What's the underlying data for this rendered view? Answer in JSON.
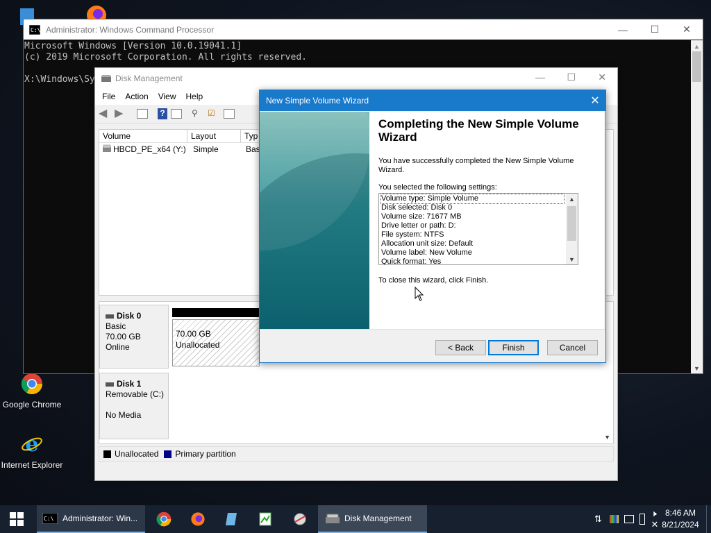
{
  "desktop": {
    "icons": [
      {
        "label": "Google Chrome"
      },
      {
        "label": "Internet Explorer"
      }
    ]
  },
  "cmd": {
    "title": "Administrator: Windows Command Processor",
    "lines": [
      "Microsoft Windows [Version 10.0.19041.1]",
      "(c) 2019 Microsoft Corporation. All rights reserved.",
      "",
      "X:\\Windows\\Sy"
    ]
  },
  "disk_mgmt": {
    "title": "Disk Management",
    "menu": [
      "File",
      "Action",
      "View",
      "Help"
    ],
    "columns": [
      "Volume",
      "Layout",
      "Typ"
    ],
    "rows": [
      {
        "volume": "HBCD_PE_x64 (Y:)",
        "layout": "Simple",
        "type": "Basi"
      }
    ],
    "disks": [
      {
        "name": "Disk 0",
        "type": "Basic",
        "size": "70.00 GB",
        "status": "Online",
        "partition_size": "70.00 GB",
        "partition_state": "Unallocated"
      },
      {
        "name": "Disk 1",
        "type": "Removable (C:)",
        "size": "",
        "status": "No Media"
      }
    ],
    "legend": [
      {
        "label": "Unallocated",
        "color": "#000000"
      },
      {
        "label": "Primary partition",
        "color": "#00008b"
      }
    ]
  },
  "wizard": {
    "title": "New Simple Volume Wizard",
    "heading": "Completing the New Simple Volume Wizard",
    "success": "You have successfully completed the New Simple Volume Wizard.",
    "settings_label": "You selected the following settings:",
    "settings": [
      "Volume type: Simple Volume",
      "Disk selected: Disk 0",
      "Volume size: 71677 MB",
      "Drive letter or path: D:",
      "File system: NTFS",
      "Allocation unit size: Default",
      "Volume label: New Volume",
      "Quick format: Yes"
    ],
    "close_hint": "To close this wizard, click Finish.",
    "back": "< Back",
    "finish": "Finish",
    "cancel": "Cancel",
    "accent": "#1979ca"
  },
  "taskbar": {
    "apps": [
      {
        "label": "Administrator: Win..."
      },
      {
        "label": "Disk Management"
      }
    ],
    "time": "8:46 AM",
    "date": "8/21/2024"
  }
}
